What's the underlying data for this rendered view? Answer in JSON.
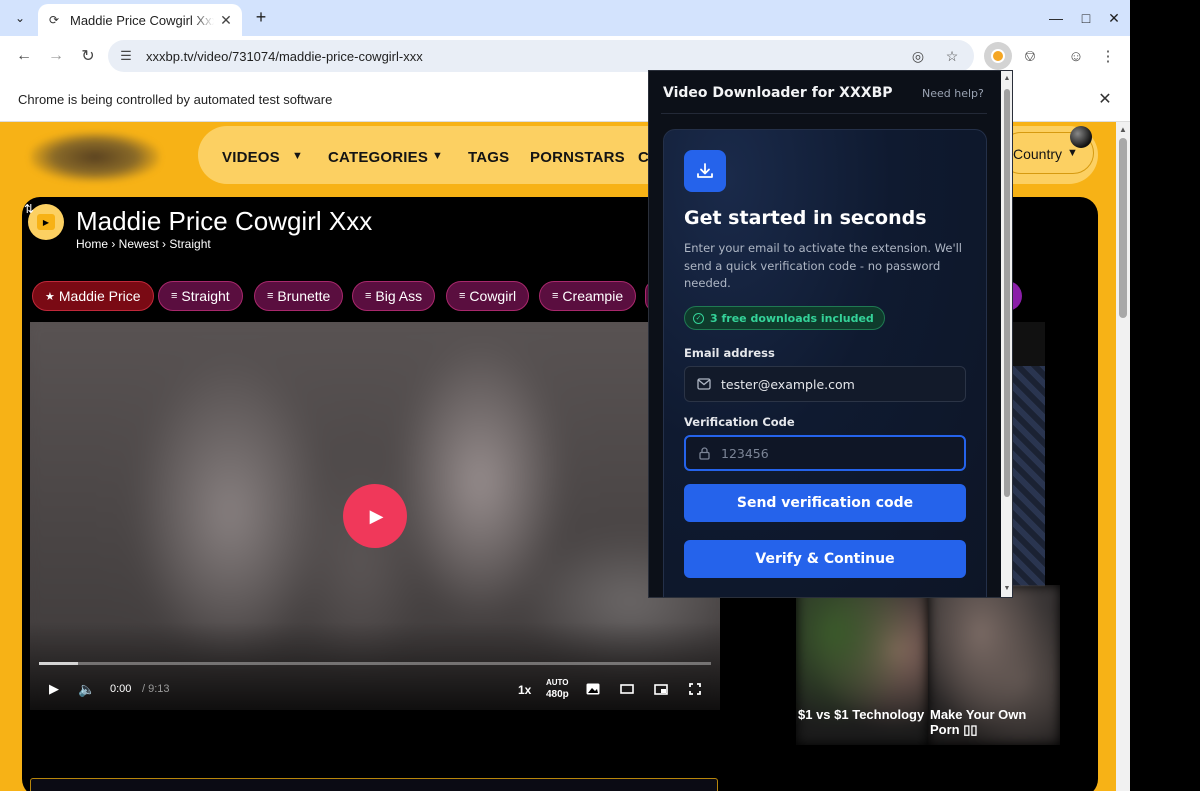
{
  "browser": {
    "tab_title": "Maddie Price Cowgirl Xxx",
    "url": "xxxbp.tv/video/731074/maddie-price-cowgirl-xxx",
    "infobar_text": "Chrome is being controlled by automated test software"
  },
  "site": {
    "nav": {
      "videos": "VIDEOS",
      "categories": "CATEGORIES",
      "tags": "TAGS",
      "pornstars": "PORNSTARS",
      "cut_item": "CH",
      "country": "Country"
    },
    "video": {
      "title": "Maddie Price Cowgirl Xxx",
      "breadcrumb": "Home › Newest › Straight",
      "tags": [
        "Maddie Price",
        "Straight",
        "Brunette",
        "Big Ass",
        "Cowgirl",
        "Creampie"
      ],
      "time_current": "0:00",
      "time_separator": " / ",
      "time_duration": "9:13",
      "speed": "1x",
      "quality_auto": "AUTO",
      "quality": "480p",
      "progress_fraction": 0.058
    },
    "ads": [
      {
        "label": "$1 vs $1 Technology"
      },
      {
        "label": "Make Your Own Porn ▯▯"
      }
    ]
  },
  "extension": {
    "title": "Video Downloader for XXXBP",
    "help": "Need help?",
    "heading": "Get started in seconds",
    "description": "Enter your email to activate the extension. We'll send a quick verification code - no password needed.",
    "badge": "3 free downloads included",
    "email_label": "Email address",
    "email_value": "tester@example.com",
    "code_label": "Verification Code",
    "code_placeholder": "123456",
    "send_button": "Send verification code",
    "verify_button": "Verify & Continue",
    "accent_color": "#2563eb",
    "badge_color": "#34d399"
  },
  "colors": {
    "site_yellow": "#f7b216",
    "tag_primary": "#7a0a14",
    "tag_default": "#5a0e3f",
    "play_button": "#f0385a"
  }
}
